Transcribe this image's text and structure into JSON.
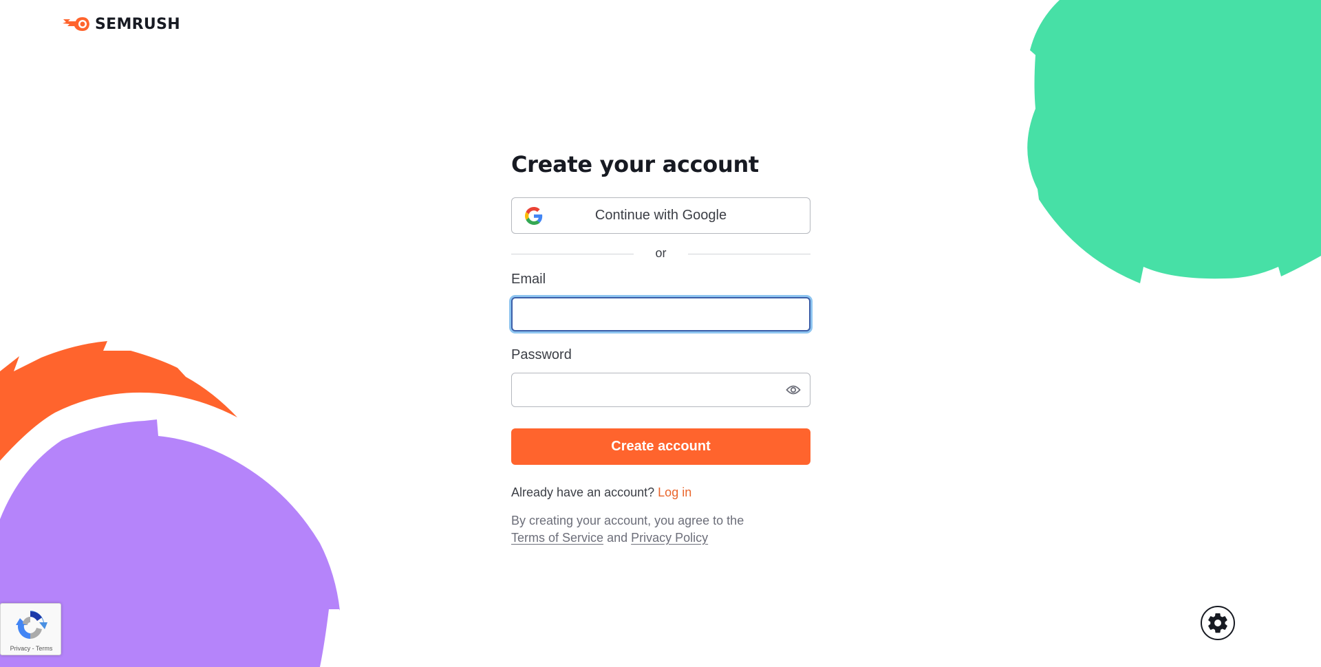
{
  "brand": {
    "name": "SEMRUSH",
    "logo_icon": "semrush-flame-icon",
    "accent_color": "#ff642d"
  },
  "form": {
    "title": "Create your account",
    "google_button": {
      "label": "Continue with Google",
      "icon": "google-g-icon"
    },
    "divider_text": "or",
    "email": {
      "label": "Email",
      "value": "",
      "placeholder": ""
    },
    "password": {
      "label": "Password",
      "value": "",
      "placeholder": "",
      "toggle_icon": "eye-icon"
    },
    "submit_label": "Create account",
    "login_prompt": "Already have an account?",
    "login_link": "Log in",
    "legal": {
      "prefix": "By creating your account, you agree to the",
      "terms_link": "Terms of Service",
      "conjunction": "and",
      "privacy_link": "Privacy Policy"
    }
  },
  "recaptcha": {
    "links_text": "Privacy - Terms"
  },
  "settings_button": {
    "icon": "gear-icon"
  },
  "decorations": {
    "green_color": "#47e0a6",
    "orange_color": "#ff642d",
    "purple_color": "#b584fa"
  }
}
